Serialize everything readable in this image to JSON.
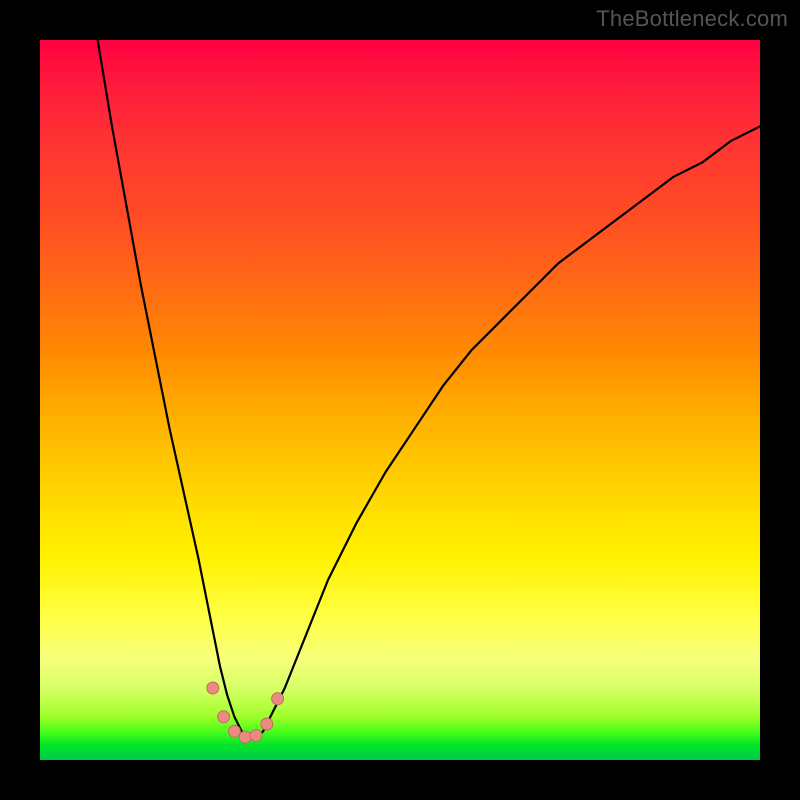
{
  "watermark": "TheBottleneck.com",
  "colors": {
    "curve_stroke": "#000000",
    "marker_fill": "#e98b80",
    "marker_stroke": "#c76a5f"
  },
  "chart_data": {
    "type": "line",
    "title": "",
    "xlabel": "",
    "ylabel": "",
    "xlim": [
      0,
      100
    ],
    "ylim": [
      0,
      100
    ],
    "gradient_meaning": "vertical color gradient from red (top, high values) through orange/yellow to green (bottom, low values)",
    "curve_note": "Single V-shaped curve; left branch descends steeply from x≈8 at y=100 to a flat minimum around x≈27-30 at y≈3, right branch rises with decreasing slope toward x=100 at y≈88. A few salmon-colored markers cluster near the trough.",
    "series": [
      {
        "name": "bottleneck-curve",
        "x": [
          8,
          10,
          12,
          14,
          16,
          18,
          20,
          22,
          24,
          25,
          26,
          27,
          28,
          29,
          30,
          31,
          32,
          34,
          36,
          38,
          40,
          44,
          48,
          52,
          56,
          60,
          64,
          68,
          72,
          76,
          80,
          84,
          88,
          92,
          96,
          100
        ],
        "y": [
          100,
          88,
          77,
          66,
          56,
          46,
          37,
          28,
          18,
          13,
          9,
          6,
          4,
          3,
          3,
          4,
          6,
          10,
          15,
          20,
          25,
          33,
          40,
          46,
          52,
          57,
          61,
          65,
          69,
          72,
          75,
          78,
          81,
          83,
          86,
          88
        ]
      }
    ],
    "markers": {
      "name": "trough-markers",
      "x": [
        24.0,
        25.5,
        27.0,
        28.5,
        30.0,
        31.5,
        33.0
      ],
      "y": [
        10.0,
        6.0,
        4.0,
        3.2,
        3.4,
        5.0,
        8.5
      ]
    }
  }
}
